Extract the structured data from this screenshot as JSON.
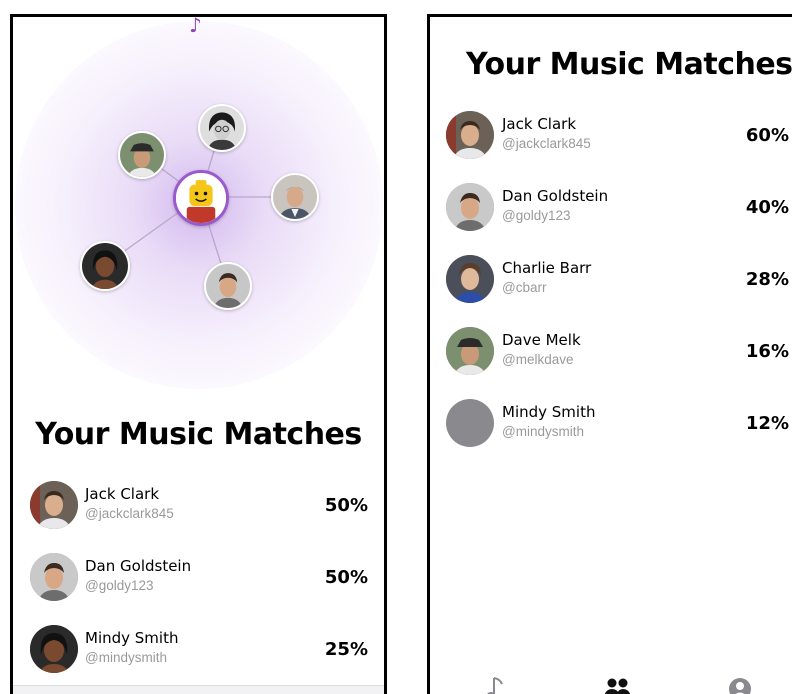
{
  "left_screen": {
    "title": "Your Music Matches",
    "matches": [
      {
        "name": "Jack Clark",
        "handle": "@jackclark845",
        "percent": "50%"
      },
      {
        "name": "Dan Goldstein",
        "handle": "@goldy123",
        "percent": "50%"
      },
      {
        "name": "Mindy Smith",
        "handle": "@mindysmith",
        "percent": "25%"
      }
    ]
  },
  "right_screen": {
    "title": "Your Music Matches",
    "matches": [
      {
        "name": "Jack Clark",
        "handle": "@jackclark845",
        "percent": "60%"
      },
      {
        "name": "Dan Goldstein",
        "handle": "@goldy123",
        "percent": "40%"
      },
      {
        "name": "Charlie Barr",
        "handle": "@cbarr",
        "percent": "28%"
      },
      {
        "name": "Dave Melk",
        "handle": "@melkdave",
        "percent": "16%"
      },
      {
        "name": "Mindy Smith",
        "handle": "@mindysmith",
        "percent": "12%"
      }
    ],
    "tabs": [
      {
        "icon": "music-note-icon"
      },
      {
        "icon": "people-icon"
      },
      {
        "icon": "profile-icon"
      }
    ]
  },
  "colors": {
    "accent_purple": "#9b59d0",
    "glow_purple": "#c4a0e8",
    "handle_gray": "#9a9a9e",
    "placeholder_avatar": "#8a8a8e"
  }
}
